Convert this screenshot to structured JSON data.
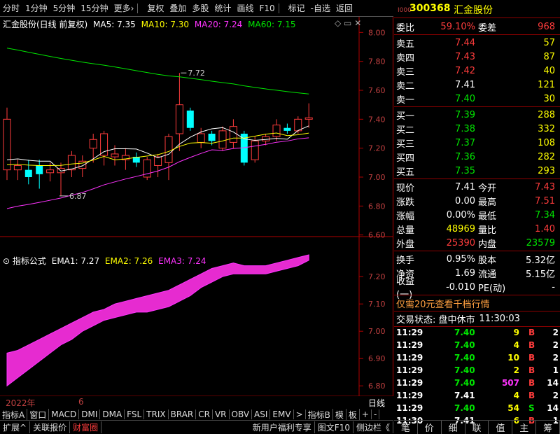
{
  "toolbar": {
    "items": [
      "分时",
      "1分钟",
      "5分钟",
      "15分钟",
      "更多›",
      "复权",
      "叠加",
      "多股",
      "统计",
      "画线",
      "F10",
      "标记",
      "-自选",
      "返回"
    ]
  },
  "stock": {
    "code": "300368",
    "name": "汇金股份",
    "prefix": "I000"
  },
  "main_legend": {
    "title": "汇金股份(日线 前复权)",
    "ma5": "MA5: 7.35",
    "ma10": "MA10: 7.30",
    "ma20": "MA20: 7.24",
    "ma60": "MA60: 7.15"
  },
  "main_axis": [
    "8.00",
    "7.80",
    "7.60",
    "7.40",
    "7.20",
    "7.00",
    "6.80",
    "6.60"
  ],
  "annotations": {
    "high": "7.72",
    "low": "6.87"
  },
  "sub_legend": {
    "title": "指标公式",
    "ema1": "EMA1: 7.27",
    "ema2": "EMA2: 7.26",
    "ema3": "EMA3: 7.24"
  },
  "sub_axis": [
    "7.20",
    "7.10",
    "7.00",
    "6.90",
    "6.80"
  ],
  "x_label": {
    "year": "2022年",
    "month": "6",
    "right": "日线"
  },
  "tabs": [
    "指标A",
    "窗口",
    "MACD",
    "DMI",
    "DMA",
    "FSL",
    "TRIX",
    "BRAR",
    "CR",
    "VR",
    "OBV",
    "ASI",
    "EMV",
    ">",
    "指标B",
    "模",
    "板",
    "+",
    "-"
  ],
  "status": [
    "扩展^",
    "关联报价",
    "财富圈",
    "新用户福利专享",
    "图文F10",
    "侧边栏《"
  ],
  "right_tabs": [
    "笔",
    "价",
    "细",
    "联",
    "值",
    "主",
    "筹"
  ],
  "weibi": {
    "label1": "委比",
    "val1": "59.10%",
    "label2": "委差",
    "val2": "968"
  },
  "sells": [
    {
      "label": "卖五",
      "price": "7.44",
      "vol": "57"
    },
    {
      "label": "卖四",
      "price": "7.43",
      "vol": "87"
    },
    {
      "label": "卖三",
      "price": "7.42",
      "vol": "40"
    },
    {
      "label": "卖二",
      "price": "7.41",
      "vol": "121"
    },
    {
      "label": "卖一",
      "price": "7.40",
      "vol": "30"
    }
  ],
  "buys": [
    {
      "label": "买一",
      "price": "7.39",
      "vol": "288"
    },
    {
      "label": "买二",
      "price": "7.38",
      "vol": "332"
    },
    {
      "label": "买三",
      "price": "7.37",
      "vol": "108"
    },
    {
      "label": "买四",
      "price": "7.36",
      "vol": "282"
    },
    {
      "label": "买五",
      "price": "7.35",
      "vol": "293"
    }
  ],
  "quote": [
    {
      "l1": "现价",
      "v1": "7.41",
      "l2": "今开",
      "v2": "7.43"
    },
    {
      "l1": "涨跌",
      "v1": "0.00",
      "l2": "最高",
      "v2": "7.51"
    },
    {
      "l1": "涨幅",
      "v1": "0.00%",
      "l2": "最低",
      "v2": "7.34"
    },
    {
      "l1": "总量",
      "v1": "48969",
      "l2": "量比",
      "v2": "1.40"
    },
    {
      "l1": "外盘",
      "v1": "25390",
      "l2": "内盘",
      "v2": "23579"
    }
  ],
  "extra": [
    {
      "l1": "换手",
      "v1": "0.95%",
      "l2": "股本",
      "v2": "5.32亿"
    },
    {
      "l1": "净资",
      "v1": "1.69",
      "l2": "流通",
      "v2": "5.15亿"
    },
    {
      "l1": "收益(一)",
      "v1": "-0.010",
      "l2": "PE(动)",
      "v2": "-"
    }
  ],
  "promo": "仅需20元查看千档行情",
  "trade_status": {
    "label": "交易状态: 盘中休市",
    "time": "11:30:03"
  },
  "trades": [
    {
      "t": "11:29",
      "p": "7.40",
      "v": "9",
      "s": "B",
      "n": "2"
    },
    {
      "t": "11:29",
      "p": "7.40",
      "v": "4",
      "s": "B",
      "n": "2"
    },
    {
      "t": "11:29",
      "p": "7.40",
      "v": "10",
      "s": "B",
      "n": "2"
    },
    {
      "t": "11:29",
      "p": "7.40",
      "v": "2",
      "s": "B",
      "n": "1"
    },
    {
      "t": "11:29",
      "p": "7.40",
      "v": "507",
      "s": "B",
      "n": "14"
    },
    {
      "t": "11:29",
      "p": "7.41",
      "v": "4",
      "s": "B",
      "n": "2"
    },
    {
      "t": "11:29",
      "p": "7.40",
      "v": "54",
      "s": "S",
      "n": "14"
    },
    {
      "t": "11:30",
      "p": "7.41",
      "v": "6",
      "s": "B",
      "n": "1"
    }
  ],
  "chart_data": {
    "type": "candlestick",
    "candles": [
      {
        "o": 7.05,
        "h": 7.48,
        "l": 6.98,
        "c": 7.4
      },
      {
        "o": 7.05,
        "h": 7.12,
        "l": 6.98,
        "c": 7.08
      },
      {
        "o": 7.05,
        "h": 7.12,
        "l": 6.95,
        "c": 7.0
      },
      {
        "o": 7.08,
        "h": 7.12,
        "l": 6.92,
        "c": 7.02
      },
      {
        "o": 7.03,
        "h": 7.1,
        "l": 6.97,
        "c": 7.05
      },
      {
        "o": 7.03,
        "h": 7.1,
        "l": 6.87,
        "c": 7.06
      },
      {
        "o": 7.05,
        "h": 7.18,
        "l": 7.0,
        "c": 7.15
      },
      {
        "o": 7.06,
        "h": 7.15,
        "l": 7.0,
        "c": 7.11
      },
      {
        "o": 7.2,
        "h": 7.3,
        "l": 7.1,
        "c": 7.26
      },
      {
        "o": 7.15,
        "h": 7.32,
        "l": 7.08,
        "c": 7.3
      },
      {
        "o": 7.14,
        "h": 7.22,
        "l": 7.08,
        "c": 7.16
      },
      {
        "o": 7.12,
        "h": 7.2,
        "l": 7.05,
        "c": 7.15
      },
      {
        "o": 7.14,
        "h": 7.17,
        "l": 7.07,
        "c": 7.1
      },
      {
        "o": 7.0,
        "h": 7.14,
        "l": 6.98,
        "c": 7.12
      },
      {
        "o": 7.08,
        "h": 7.16,
        "l": 7.0,
        "c": 7.14
      },
      {
        "o": 7.1,
        "h": 7.3,
        "l": 6.98,
        "c": 7.28
      },
      {
        "o": 7.3,
        "h": 7.72,
        "l": 7.18,
        "c": 7.5
      },
      {
        "o": 7.46,
        "h": 7.48,
        "l": 7.32,
        "c": 7.34
      },
      {
        "o": 7.24,
        "h": 7.34,
        "l": 7.2,
        "c": 7.3
      },
      {
        "o": 7.3,
        "h": 7.32,
        "l": 7.22,
        "c": 7.25
      },
      {
        "o": 7.2,
        "h": 7.35,
        "l": 7.18,
        "c": 7.32
      },
      {
        "o": 7.24,
        "h": 7.4,
        "l": 7.2,
        "c": 7.35
      },
      {
        "o": 7.3,
        "h": 7.32,
        "l": 7.08,
        "c": 7.1
      },
      {
        "o": 7.12,
        "h": 7.28,
        "l": 7.1,
        "c": 7.25
      },
      {
        "o": 7.25,
        "h": 7.3,
        "l": 7.22,
        "c": 7.28
      },
      {
        "o": 7.28,
        "h": 7.4,
        "l": 7.25,
        "c": 7.36
      },
      {
        "o": 7.34,
        "h": 7.37,
        "l": 7.3,
        "c": 7.32
      },
      {
        "o": 7.32,
        "h": 7.42,
        "l": 7.3,
        "c": 7.4
      },
      {
        "o": 7.4,
        "h": 7.51,
        "l": 7.34,
        "c": 7.41
      }
    ],
    "ylim": [
      6.55,
      8.05
    ],
    "ema_band": {
      "upper": [
        6.92,
        6.93,
        6.95,
        6.97,
        6.99,
        7.01,
        7.03,
        7.05,
        7.07,
        7.08,
        7.1,
        7.11,
        7.12,
        7.13,
        7.14,
        7.15,
        7.17,
        7.19,
        7.21,
        7.23,
        7.24,
        7.25,
        7.24,
        7.24,
        7.24,
        7.25,
        7.26,
        7.27,
        7.28
      ],
      "lower": [
        6.8,
        6.83,
        6.86,
        6.89,
        6.92,
        6.95,
        6.97,
        7.0,
        7.02,
        7.04,
        7.05,
        7.06,
        7.07,
        7.07,
        7.08,
        7.09,
        7.11,
        7.13,
        7.16,
        7.18,
        7.2,
        7.21,
        7.21,
        7.21,
        7.21,
        7.22,
        7.23,
        7.24,
        7.26
      ],
      "ylim": [
        6.78,
        7.28
      ]
    }
  }
}
